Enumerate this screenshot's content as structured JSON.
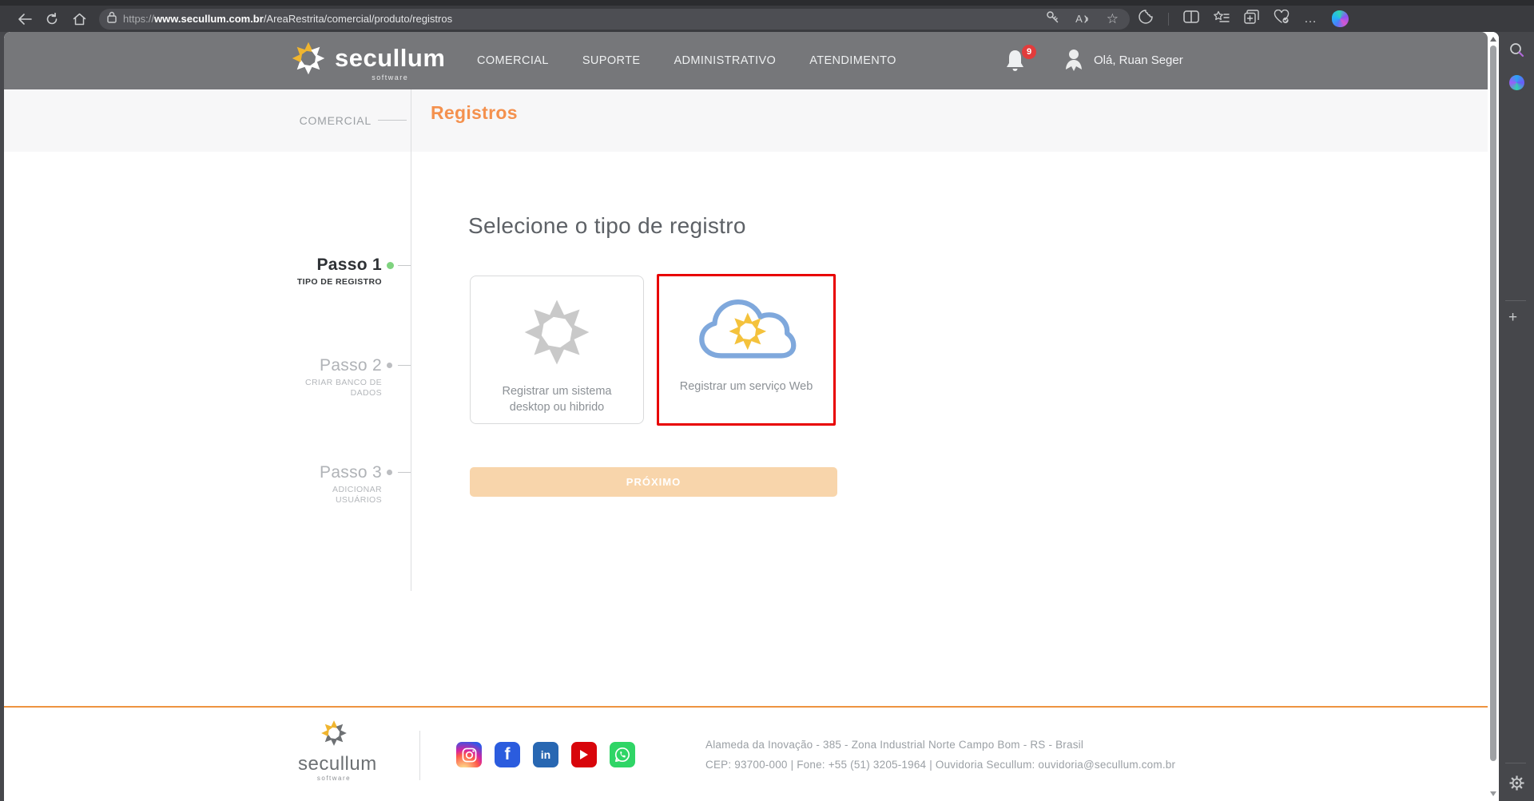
{
  "browser": {
    "url": {
      "scheme": "https://",
      "domain": "www.secullum.com.br",
      "path": "/AreaRestrita/comercial/produto/registros"
    }
  },
  "site_header": {
    "logo_text": "secullum",
    "logo_subtext": "software",
    "nav": [
      {
        "label": "COMERCIAL"
      },
      {
        "label": "SUPORTE"
      },
      {
        "label": "ADMINISTRATIVO"
      },
      {
        "label": "ATENDIMENTO"
      }
    ],
    "notifications_badge": "9",
    "user_greeting": "Olá, Ruan Seger"
  },
  "breadcrumb": {
    "section": "COMERCIAL"
  },
  "page": {
    "title": "Registros"
  },
  "wizard": {
    "steps": [
      {
        "title": "Passo 1",
        "subtitle": "TIPO DE REGISTRO",
        "state": "active"
      },
      {
        "title": "Passo 2",
        "subtitle": "CRIAR BANCO DE DADOS",
        "state": "pending"
      },
      {
        "title": "Passo 3",
        "subtitle": "ADICIONAR USUÁRIOS",
        "state": "pending"
      }
    ]
  },
  "content": {
    "heading": "Selecione o tipo de registro",
    "options": [
      {
        "label": "Registrar um sistema desktop ou hibrido",
        "selected": false
      },
      {
        "label": "Registrar um serviço Web",
        "selected": true
      }
    ],
    "next_button_label": "PRÓXIMO"
  },
  "footer": {
    "logo_text": "secullum",
    "logo_subtext": "software",
    "social_icons": [
      "instagram",
      "facebook",
      "linkedin",
      "youtube",
      "whatsapp"
    ],
    "address_line1": "Alameda da Inovação - 385 - Zona Industrial Norte Campo Bom - RS - Brasil",
    "contact_line": "CEP: 93700-000 | Fone: +55 (51) 3205-1964 | Ouvidoria Secullum: ouvidoria@secullum.com.br"
  },
  "colors": {
    "accent_orange": "#f4914e",
    "footer_rule_orange": "#ee9340",
    "selected_border_red": "#e80000",
    "active_step_green": "#7fd37f",
    "brand_yellow": "#f0b52f",
    "cloud_blue": "#7fa8dc",
    "header_gray": "#76777a",
    "disabled_button_bg": "#f8d5ab"
  },
  "icons": {
    "favorites_star": "☆",
    "more_options": "…",
    "plus": "+",
    "read_aloud_letter": "A",
    "facebook_glyph": "f",
    "linkedin_glyph": "in"
  }
}
